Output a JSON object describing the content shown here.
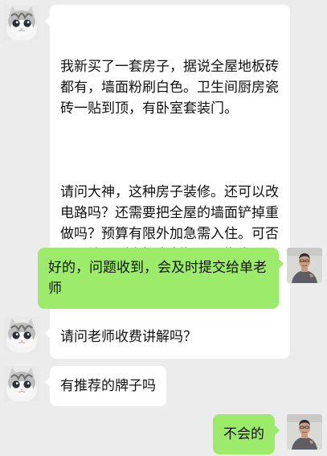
{
  "messages": [
    {
      "sender": "other",
      "avatar": "cat-avatar",
      "paragraphs": [
        "我新买了一套房子，据说全屋地板砖都有，墙面粉刷白色。卫生间厨房瓷砖一贴到顶，有卧室套装门。",
        "请问大神，这种房子装修。还可以改电路吗？还需要把全屋的墙面铲掉重做吗？预算有限外加急需入住。可否不刷墙面（直接定制橱子，搬家具入住）。或者不刮腻子直接刷漆？可否这样？"
      ]
    },
    {
      "sender": "self",
      "avatar": "man-avatar",
      "text": "好的，问题收到，会及时提交给单老师"
    },
    {
      "sender": "other",
      "avatar": "cat-avatar",
      "text": "请问老师收费讲解吗？"
    },
    {
      "sender": "other",
      "avatar": "cat-avatar",
      "text": "有推荐的牌子吗"
    },
    {
      "sender": "self",
      "avatar": "man-avatar",
      "text": "不会的"
    }
  ],
  "colors": {
    "background": "#ececec",
    "incoming_bubble": "#ffffff",
    "outgoing_bubble": "#9ceb6a"
  }
}
